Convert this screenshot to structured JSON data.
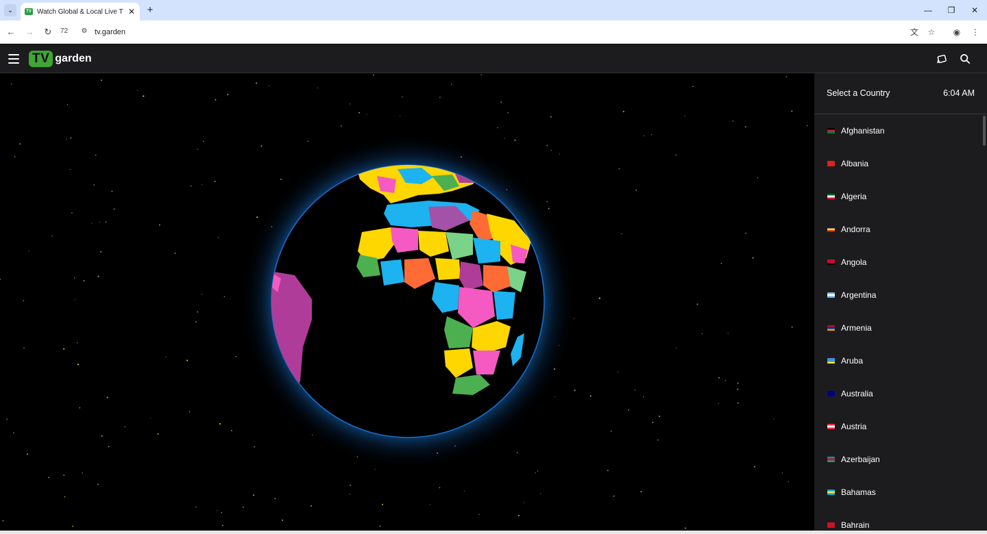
{
  "browser": {
    "tab_title": "Watch Global & Local Live TV Channels",
    "url": "tv.garden",
    "zoom_label": "72",
    "tab_favicon_text": "TV"
  },
  "app": {
    "logo_tv": "TV",
    "logo_garden": "garden"
  },
  "sidebar": {
    "title": "Select a Country",
    "time": "6:04 AM",
    "countries": [
      {
        "name": "Afghanistan",
        "flag_colors": [
          "#000000",
          "#d32011",
          "#007a36"
        ]
      },
      {
        "name": "Albania",
        "flag_colors": [
          "#e41e20",
          "#e41e20",
          "#e41e20"
        ]
      },
      {
        "name": "Algeria",
        "flag_colors": [
          "#006233",
          "#ffffff",
          "#d21034"
        ]
      },
      {
        "name": "Andorra",
        "flag_colors": [
          "#10069f",
          "#fedf00",
          "#d50032"
        ]
      },
      {
        "name": "Angola",
        "flag_colors": [
          "#cc092f",
          "#cc092f",
          "#000000"
        ]
      },
      {
        "name": "Argentina",
        "flag_colors": [
          "#74acdf",
          "#ffffff",
          "#74acdf"
        ]
      },
      {
        "name": "Armenia",
        "flag_colors": [
          "#d90012",
          "#0033a0",
          "#f2a800"
        ]
      },
      {
        "name": "Aruba",
        "flag_colors": [
          "#418fde",
          "#418fde",
          "#f9e814"
        ]
      },
      {
        "name": "Australia",
        "flag_colors": [
          "#00008b",
          "#00008b",
          "#00008b"
        ]
      },
      {
        "name": "Austria",
        "flag_colors": [
          "#ed2939",
          "#ffffff",
          "#ed2939"
        ]
      },
      {
        "name": "Azerbaijan",
        "flag_colors": [
          "#0092bc",
          "#e4002b",
          "#00af66"
        ]
      },
      {
        "name": "Bahamas",
        "flag_colors": [
          "#00abc9",
          "#fae042",
          "#00abc9"
        ]
      },
      {
        "name": "Bahrain",
        "flag_colors": [
          "#ce1126",
          "#ce1126",
          "#ce1126"
        ]
      }
    ]
  },
  "icons": {
    "menu": "hamburger-icon",
    "cast": "cast-icon",
    "search": "search-icon"
  }
}
